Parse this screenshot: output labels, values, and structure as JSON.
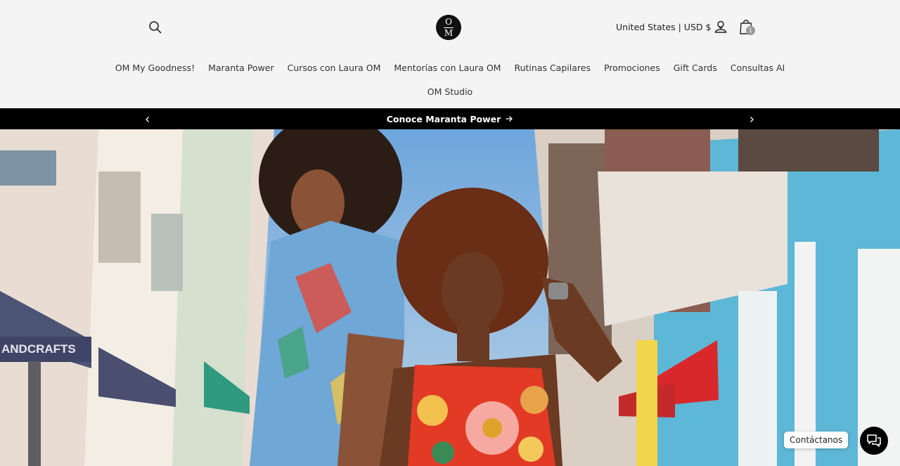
{
  "header": {
    "logo": {
      "top": "O",
      "bottom": "M"
    },
    "locale_label": "United States | USD $",
    "cart_count": "1"
  },
  "nav": {
    "row1": [
      "OM My Goodness!",
      "Maranta Power",
      "Cursos con Laura OM",
      "Mentorías con Laura OM",
      "Rutinas Capilares",
      "Promociones",
      "Gift Cards",
      "Consultas AI"
    ],
    "row2": [
      "OM Studio"
    ]
  },
  "announcement": {
    "text": "Conoce Maranta Power"
  },
  "hero": {
    "storefront_sign": "ANDCRAFTS"
  },
  "chat": {
    "label": "Contáctanos"
  },
  "colors": {
    "announcement_bg": "#000000",
    "page_bg": "#f4f4f4",
    "accent": "#111111"
  },
  "icons": [
    "search-icon",
    "chevron-down-icon",
    "user-icon",
    "cart-icon",
    "chevron-left-icon",
    "chevron-right-icon",
    "arrow-right-icon",
    "chat-icon"
  ]
}
